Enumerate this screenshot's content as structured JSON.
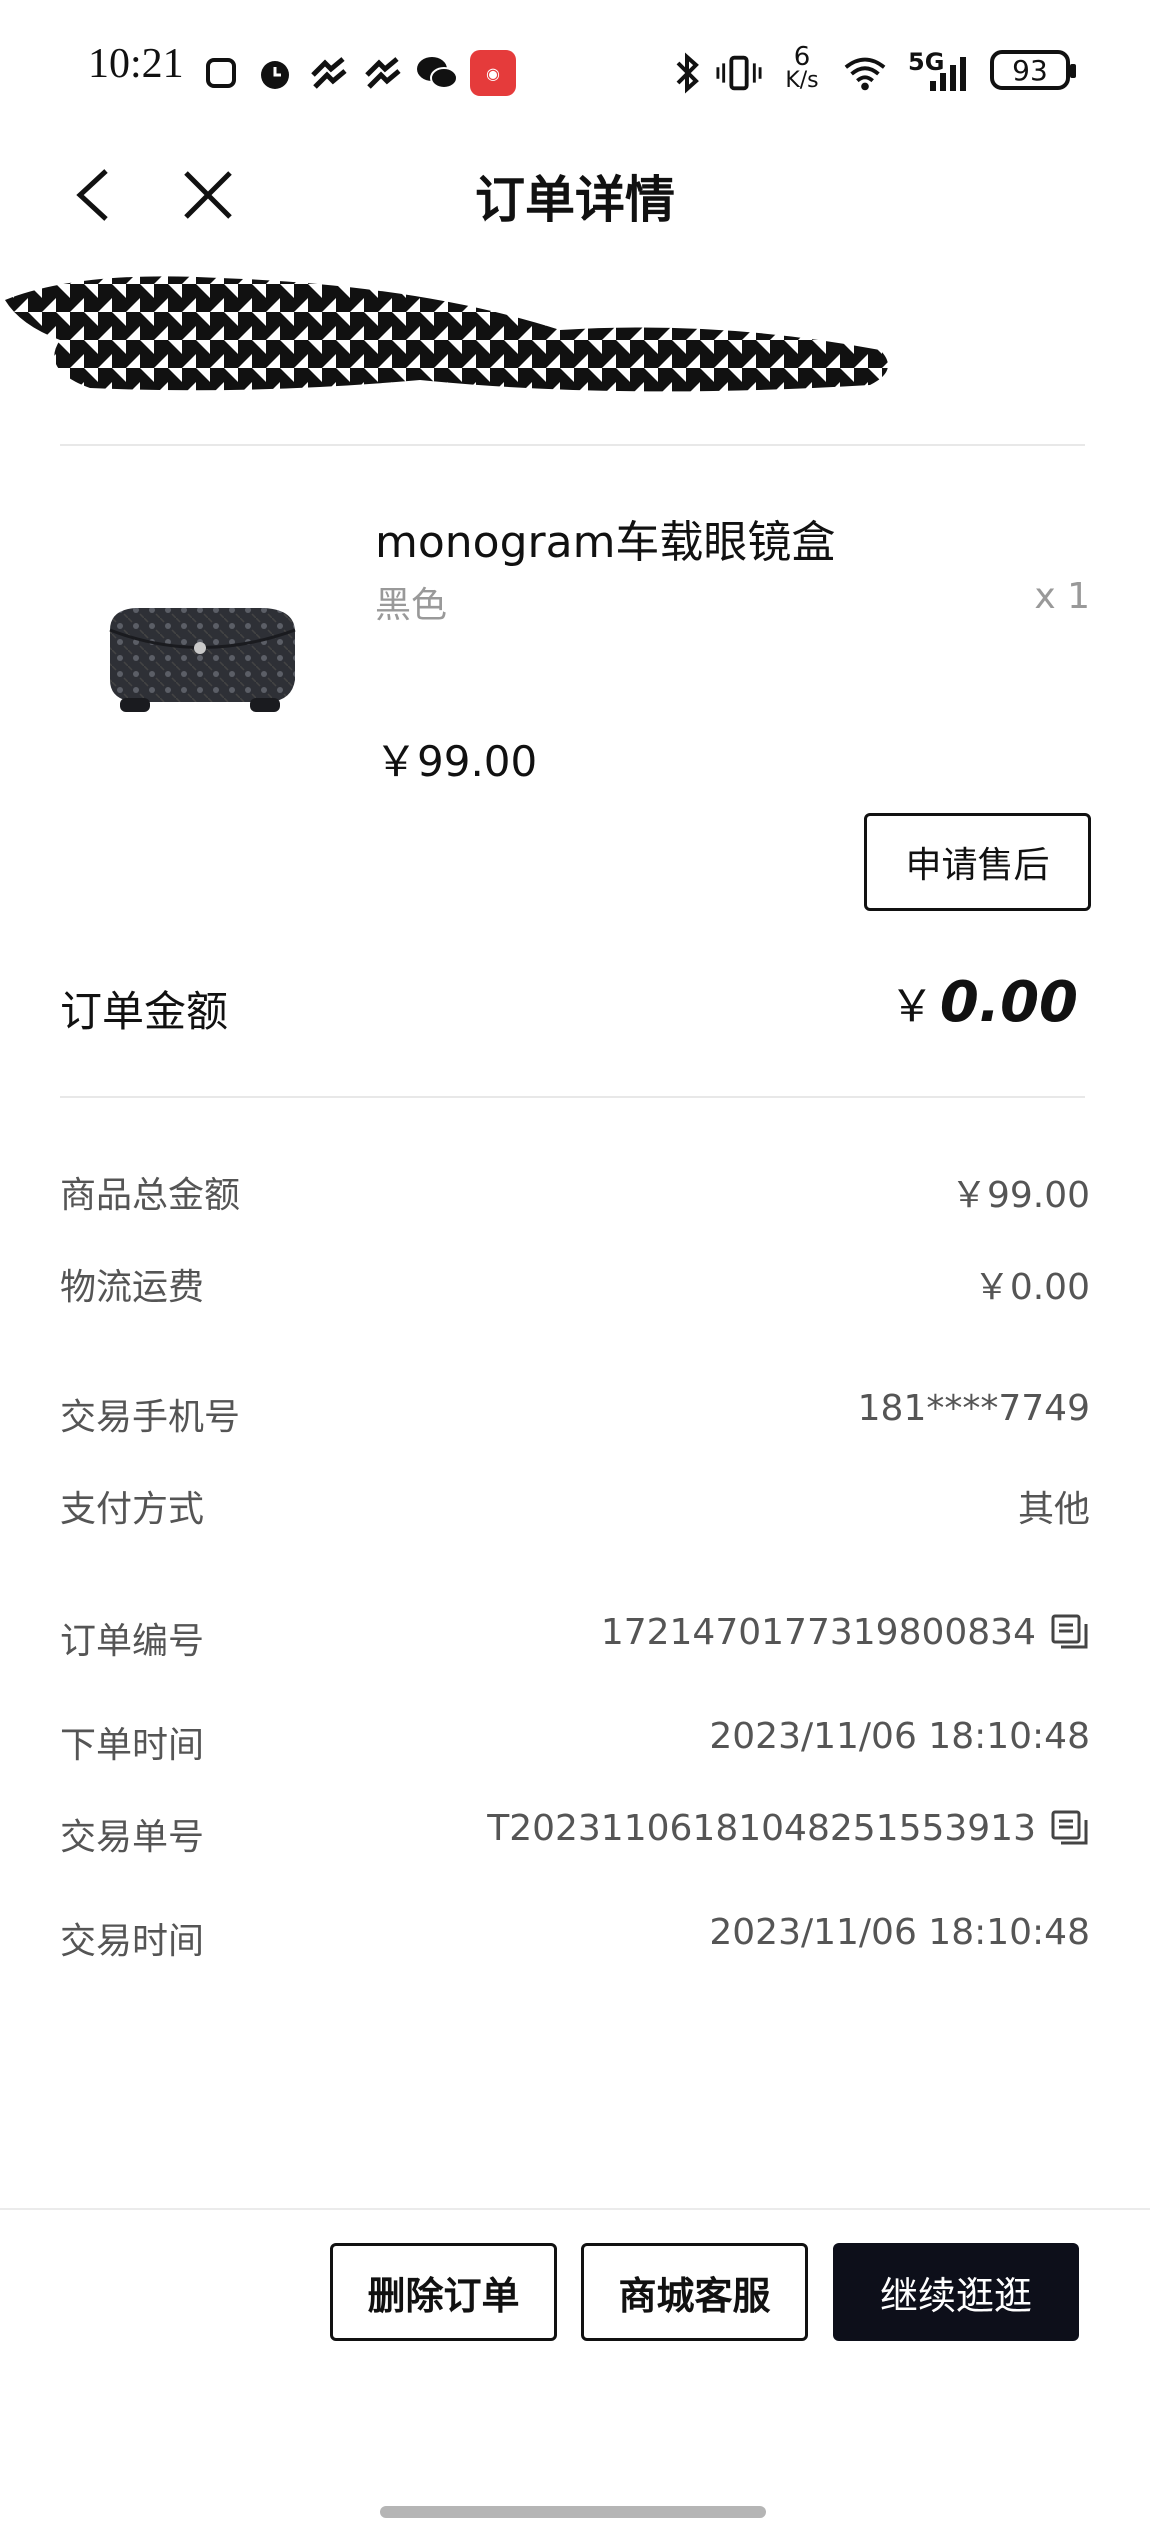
{
  "status_bar": {
    "time": "10:21",
    "net_speed_top": "6",
    "net_speed_unit": "K/s",
    "signal_label": "5G",
    "battery": "93"
  },
  "header": {
    "title": "订单详情"
  },
  "product": {
    "name": "monogram车载眼镜盒",
    "variant": "黑色",
    "quantity": "x 1",
    "price": "￥99.00",
    "after_sale_label": "申请售后"
  },
  "order_total": {
    "label": "订单金额",
    "currency": "￥",
    "amount": "0.00"
  },
  "details": [
    {
      "label": "商品总金额",
      "value": "￥99.00"
    },
    {
      "label": "物流运费",
      "value": "￥0.00"
    },
    {
      "label": "交易手机号",
      "value": "181****7749"
    },
    {
      "label": "支付方式",
      "value": "其他"
    },
    {
      "label": "订单编号",
      "value": "1721470177319800834"
    },
    {
      "label": "下单时间",
      "value": "2023/11/06 18:10:48"
    },
    {
      "label": "交易单号",
      "value": "T20231106181048251553913"
    },
    {
      "label": "交易时间",
      "value": "2023/11/06 18:10:48"
    }
  ],
  "actions": {
    "delete_order": "删除订单",
    "customer_service": "商城客服",
    "continue_shopping": "继续逛逛"
  },
  "colors": {
    "primary_button": "#0d0f1a",
    "muted_text": "#999999"
  }
}
